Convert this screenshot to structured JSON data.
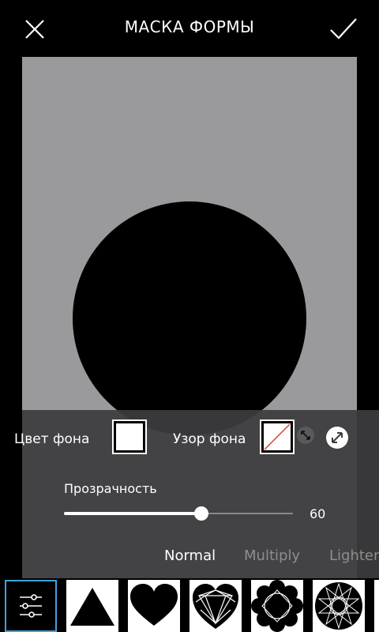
{
  "header": {
    "title": "МАСКА ФОРМЫ"
  },
  "icons": {
    "close": "close-icon",
    "confirm": "checkmark-icon",
    "resize": "resize-icon",
    "expand": "expand-icon",
    "settings": "sliders-icon"
  },
  "panel": {
    "background_color_label": "Цвет фона",
    "background_pattern_label": "Узор фона",
    "opacity_label": "Прозрачность",
    "opacity_value": "60",
    "opacity_fraction": 0.6,
    "blend_modes": [
      "Normal",
      "Multiply",
      "Lighten"
    ],
    "selected_blend_mode": "Normal"
  },
  "shapes": [
    "triangle",
    "heart",
    "gem",
    "flower",
    "star-burst"
  ],
  "colors": {
    "canvas": "#9a999c",
    "panel": "#3c3c3e",
    "accent": "#3fa3dc",
    "pattern_slash": "#e53935"
  }
}
